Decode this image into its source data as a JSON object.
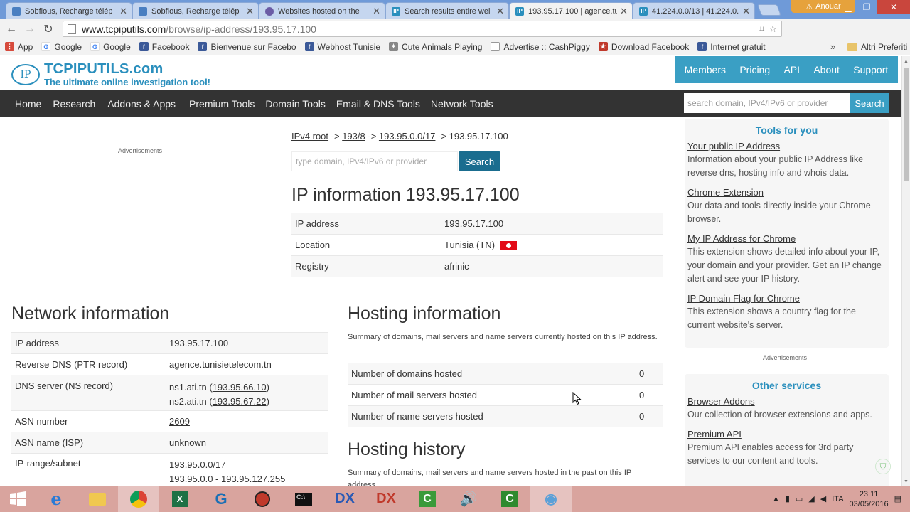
{
  "browser": {
    "tabs": [
      {
        "title": "Sobflous, Recharge télép",
        "active": false,
        "favicon_color": "#4a7fc1"
      },
      {
        "title": "Sobflous, Recharge télép",
        "active": false,
        "favicon_color": "#4a7fc1"
      },
      {
        "title": "Websites hosted on the",
        "active": false,
        "favicon_color": "#6b5ca5"
      },
      {
        "title": "Search results entire wel",
        "active": false,
        "favicon_color": "#2a8fbd"
      },
      {
        "title": "193.95.17.100 | agence.tu",
        "active": true,
        "favicon_color": "#2a8fbd"
      },
      {
        "title": "41.224.0.0/13 | 41.224.0.",
        "active": false,
        "favicon_color": "#2a8fbd"
      }
    ],
    "user_name": "Anouar",
    "url_host": "www.tcpiputils.com",
    "url_path": "/browse/ip-address/193.95.17.100",
    "bookmarks": [
      {
        "label": "App",
        "icon": "apps-grid-icon",
        "color": "#d64a3c"
      },
      {
        "label": "Google",
        "icon": "google-icon",
        "color": "#4285f4"
      },
      {
        "label": "Google",
        "icon": "google-icon",
        "color": "#4285f4"
      },
      {
        "label": "Facebook",
        "icon": "facebook-icon",
        "color": "#3b5998"
      },
      {
        "label": "Bienvenue sur Facebo",
        "icon": "facebook-icon",
        "color": "#3b5998"
      },
      {
        "label": "Webhost Tunisie",
        "icon": "facebook-icon",
        "color": "#3b5998"
      },
      {
        "label": "Cute Animals Playing",
        "icon": "puzzle-icon",
        "color": "#888888"
      },
      {
        "label": "Advertise :: CashPiggy",
        "icon": "page-icon",
        "color": "#999999"
      },
      {
        "label": "Download Facebook",
        "icon": "download-icon",
        "color": "#c0392b"
      },
      {
        "label": "Internet gratuit",
        "icon": "facebook-icon",
        "color": "#3b5998"
      }
    ],
    "bookmarks_more": "»",
    "other_bookmarks": "Altri Preferiti"
  },
  "site": {
    "logo_mark": "IP",
    "logo_name": "TCPIPUTILS.com",
    "logo_tagline": "The ultimate online investigation tool!",
    "top_nav": [
      "Members",
      "Pricing",
      "API",
      "About",
      "Support"
    ],
    "main_nav": [
      "Home",
      "Research",
      "Addons & Apps",
      "Premium Tools",
      "Domain Tools",
      "Email & DNS Tools",
      "Network Tools"
    ],
    "search_placeholder": "search domain, IPv4/IPv6 or provider",
    "search_button": "Search",
    "accent": "#3a9fc4",
    "dark_bar": "#333333"
  },
  "content": {
    "ads_label": "Advertisements",
    "breadcrumb": {
      "root": "IPv4 root",
      "l1": "193/8",
      "l2": "193.95.0.0/17",
      "current": "193.95.17.100",
      "sep": "->"
    },
    "search_placeholder": "type domain, IPv4/IPv6 or provider",
    "search_button": "Search",
    "ip_info": {
      "title": "IP information 193.95.17.100",
      "rows": [
        {
          "key": "IP address",
          "value": "193.95.17.100"
        },
        {
          "key": "Location",
          "value": "Tunisia (TN)"
        },
        {
          "key": "Registry",
          "value": "afrinic"
        }
      ]
    },
    "network": {
      "title": "Network information",
      "ip_key": "IP address",
      "ip_val": "193.95.17.100",
      "rdns_key": "Reverse DNS (PTR record)",
      "rdns_val": "agence.tunisietelecom.tn",
      "dns_key": "DNS server (NS record)",
      "ns1_name": "ns1.ati.tn (",
      "ns1_ip": "193.95.66.10",
      "ns1_close": ")",
      "ns2_name": "ns2.ati.tn (",
      "ns2_ip": "193.95.67.22",
      "ns2_close": ")",
      "asn_key": "ASN number",
      "asn_val": "2609",
      "asname_key": "ASN name (ISP)",
      "asname_val": "unknown",
      "range_key": "IP-range/subnet",
      "range_link": "193.95.0.0/17",
      "range_span": "193.95.0.0 - 193.95.127.255"
    },
    "hosting": {
      "title": "Hosting information",
      "summary": "Summary of domains, mail servers and name servers currently hosted on this IP address.",
      "rows": [
        {
          "key": "Number of domains hosted",
          "value": "0"
        },
        {
          "key": "Number of mail servers hosted",
          "value": "0"
        },
        {
          "key": "Number of name servers hosted",
          "value": "0"
        }
      ]
    },
    "history": {
      "title": "Hosting history",
      "summary": "Summary of domains, mail servers and name servers hosted in the past on this IP address."
    }
  },
  "sidebar": {
    "tools_title": "Tools for you",
    "tools": [
      {
        "link": "Your public IP Address",
        "desc": "Information about your public IP Address like reverse dns, hosting info and whois data."
      },
      {
        "link": "Chrome Extension",
        "desc": "Our data and tools directly inside your Chrome browser."
      },
      {
        "link": "My IP Address for Chrome",
        "desc": "This extension shows detailed info about your IP, your domain and your provider. Get an IP change alert and see your IP history."
      },
      {
        "link": "IP Domain Flag for Chrome",
        "desc": "This extension shows a country flag for the current website's server."
      }
    ],
    "ads_label": "Advertisements",
    "services_title": "Other services",
    "services": [
      {
        "link": "Browser Addons",
        "desc": "Our collection of browser extensions and apps."
      },
      {
        "link": "Premium API",
        "desc": "Premium API enables access for 3rd party services to our content and tools."
      }
    ]
  },
  "taskbar": {
    "apps": [
      "ie-icon",
      "explorer-icon",
      "chrome-icon",
      "excel-icon",
      "ccleaner-icon",
      "app-red-icon",
      "cmd-icon",
      "dx-icon",
      "dx-icon",
      "camtasia-icon",
      "speaker-icon",
      "camtasia-icon",
      "eye-icon"
    ],
    "language": "ITA",
    "time": "23.11",
    "date": "03/05/2016"
  }
}
